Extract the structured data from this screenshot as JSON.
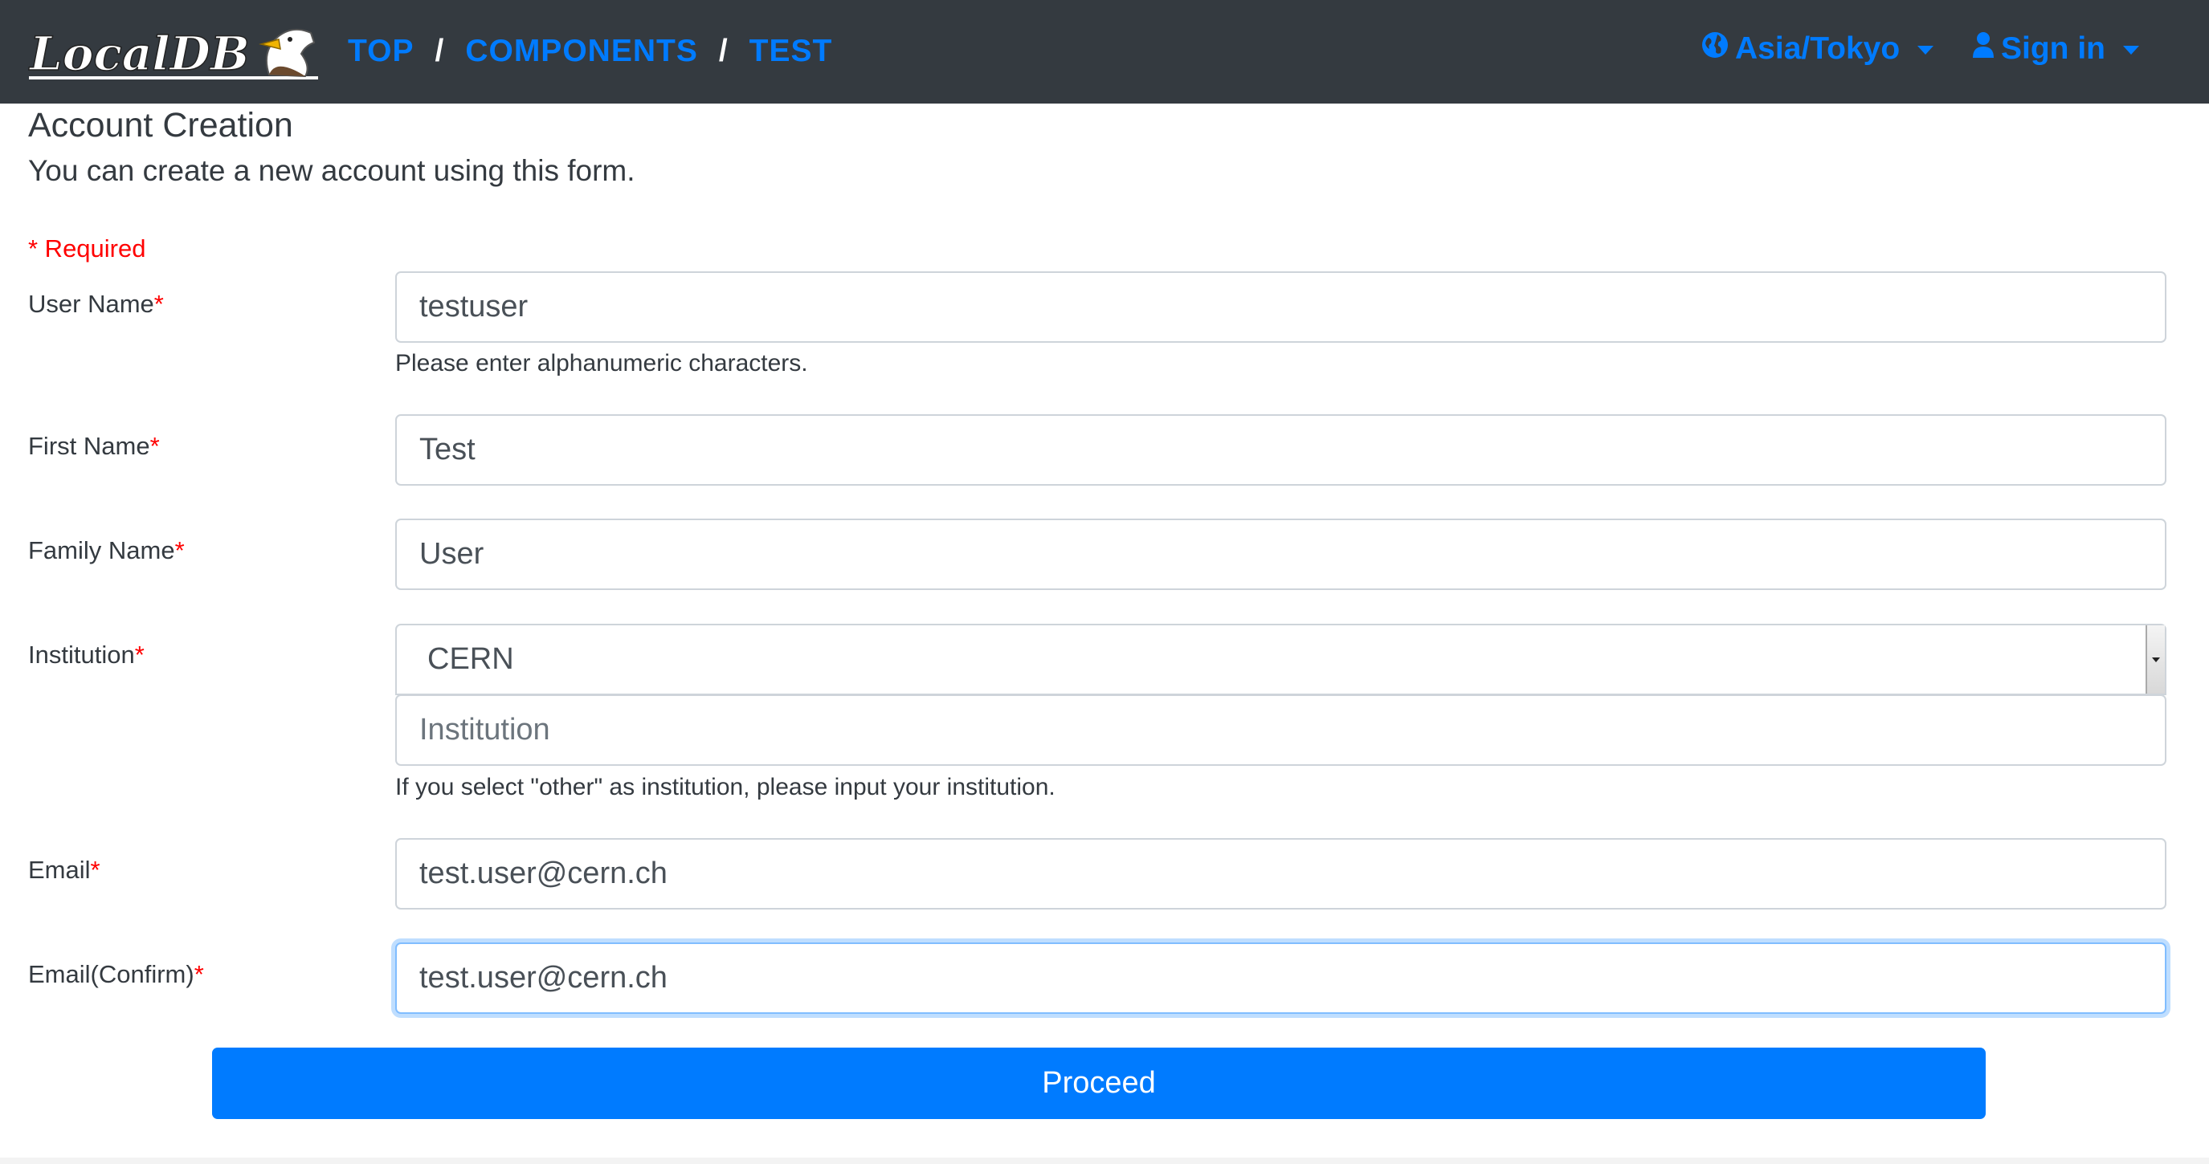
{
  "navbar": {
    "logo_text": "LocalDB",
    "breadcrumb": [
      "TOP",
      "COMPONENTS",
      "TEST"
    ],
    "breadcrumb_separator": "/",
    "timezone_label": "Asia/Tokyo",
    "timezone_icon": "globe-icon",
    "signin_label": "Sign in",
    "signin_icon": "user-icon",
    "background_color": "#343a40",
    "link_color": "#007bff"
  },
  "page": {
    "title": "Account Creation",
    "subtitle": "You can create a new account using this form.",
    "required_note": "* Required",
    "required_marker": "*"
  },
  "form": {
    "username": {
      "label": "User Name",
      "value": "testuser",
      "help": "Please enter alphanumeric characters."
    },
    "first_name": {
      "label": "First Name",
      "value": "Test"
    },
    "family_name": {
      "label": "Family Name",
      "value": "User"
    },
    "institution": {
      "label": "Institution",
      "selected": "CERN",
      "other_placeholder": "Institution",
      "help": "If you select \"other\" as institution, please input your institution."
    },
    "email": {
      "label": "Email",
      "value": "test.user@cern.ch"
    },
    "email_confirm": {
      "label": "Email(Confirm)",
      "value": "test.user@cern.ch"
    },
    "submit_label": "Proceed",
    "submit_color": "#007bff"
  }
}
